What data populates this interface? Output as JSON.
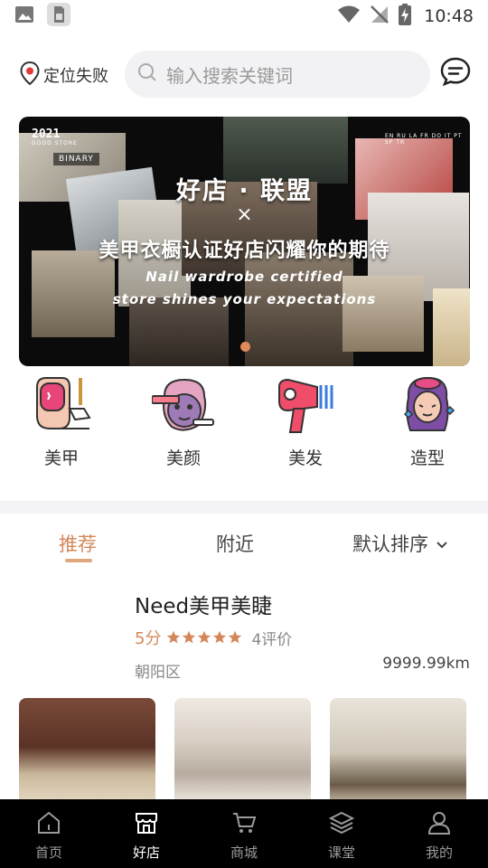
{
  "status_bar": {
    "time": "10:48"
  },
  "header": {
    "location_label": "定位失败",
    "search_placeholder": "输入搜索关键词"
  },
  "banner": {
    "title": "好店 · 联盟",
    "x_mark": "×",
    "headline_cn": "美甲衣橱认证好店闪耀你的期待",
    "headline_en_line1": "Nail wardrobe certified",
    "headline_en_line2": "store shines your expectations",
    "year": "2021",
    "year_sub": "GOOD STORE",
    "photo_tag": "BINARY",
    "photo_tag2": "EN RU LA FR DO IT PT SP TR"
  },
  "categories": [
    {
      "label": "美甲",
      "icon": "nail-icon"
    },
    {
      "label": "美颜",
      "icon": "face-beauty-icon"
    },
    {
      "label": "美发",
      "icon": "hair-dryer-icon"
    },
    {
      "label": "造型",
      "icon": "styling-icon"
    }
  ],
  "tabs": {
    "recommend": "推荐",
    "nearby": "附近",
    "sort": "默认排序"
  },
  "store": {
    "name": "Need美甲美睫",
    "score": "5分",
    "stars": 5,
    "reviews": "4评价",
    "district": "朝阳区",
    "distance": "9999.99km"
  },
  "bottom_nav": [
    {
      "label": "首页",
      "icon": "home-icon",
      "active": false
    },
    {
      "label": "好店",
      "icon": "store-icon",
      "active": true
    },
    {
      "label": "商城",
      "icon": "cart-icon",
      "active": false
    },
    {
      "label": "课堂",
      "icon": "layers-icon",
      "active": false
    },
    {
      "label": "我的",
      "icon": "user-icon",
      "active": false
    }
  ],
  "colors": {
    "accent": "#d4885a",
    "star": "#d4885a",
    "nav_bg": "#000000"
  }
}
